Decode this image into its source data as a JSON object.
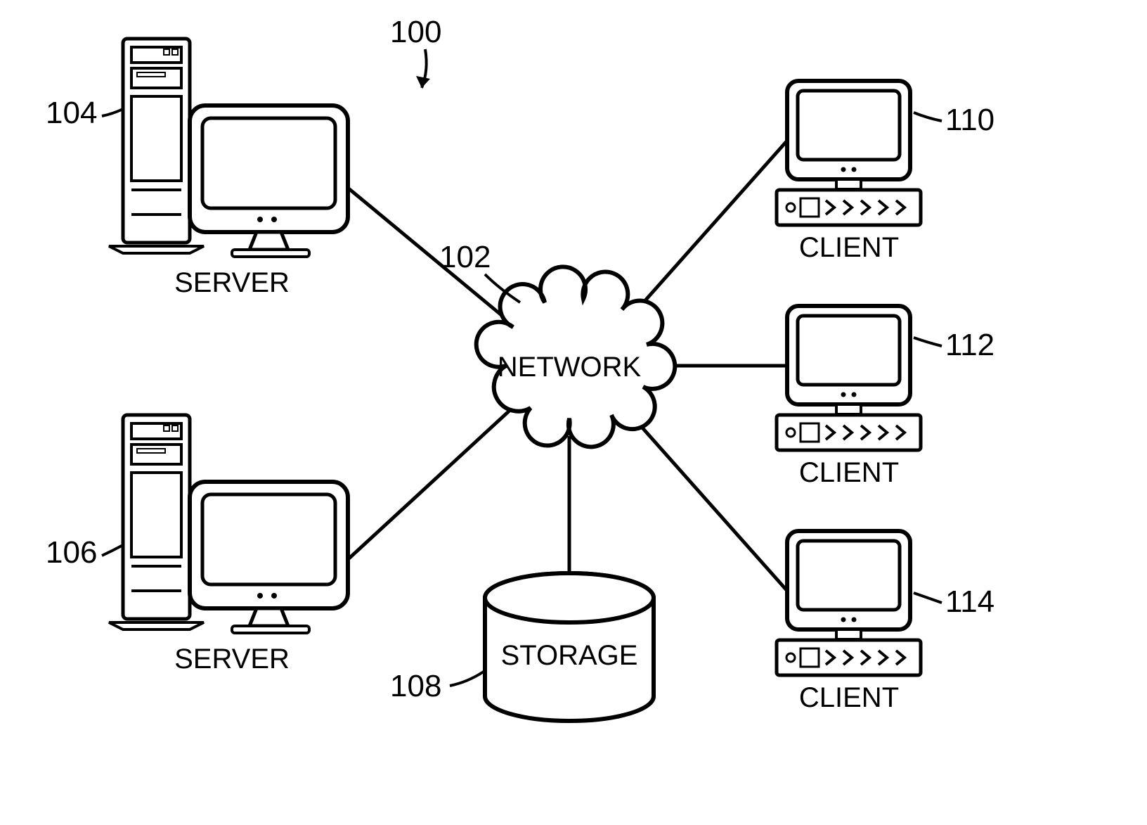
{
  "diagram": {
    "figure_ref": "100",
    "network": {
      "ref": "102",
      "label": "NETWORK"
    },
    "storage": {
      "ref": "108",
      "label": "STORAGE"
    },
    "servers": [
      {
        "ref": "104",
        "label": "SERVER"
      },
      {
        "ref": "106",
        "label": "SERVER"
      }
    ],
    "clients": [
      {
        "ref": "110",
        "label": "CLIENT"
      },
      {
        "ref": "112",
        "label": "CLIENT"
      },
      {
        "ref": "114",
        "label": "CLIENT"
      }
    ]
  }
}
